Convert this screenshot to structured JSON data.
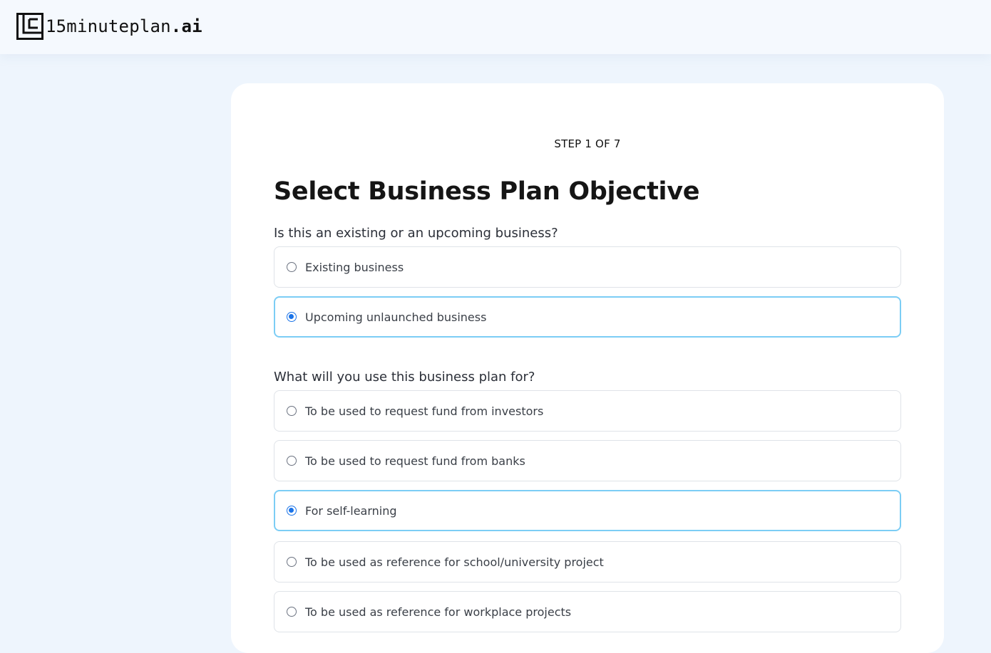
{
  "brand": {
    "name": "15minuteplan",
    "tld": ".ai"
  },
  "form": {
    "step_label": "STEP 1 OF 7",
    "title": "Select Business Plan Objective",
    "question_1": {
      "text": "Is this an existing or an upcoming business?",
      "options": [
        {
          "label": "Existing business",
          "selected": false
        },
        {
          "label": "Upcoming unlaunched business",
          "selected": true
        }
      ]
    },
    "question_2": {
      "text": "What will you use this business plan for?",
      "options": [
        {
          "label": "To be used to request fund from investors",
          "selected": false
        },
        {
          "label": "To be used to request fund from banks",
          "selected": false
        },
        {
          "label": "For self-learning",
          "selected": true
        },
        {
          "label": "To be used as reference for school/university project",
          "selected": false
        },
        {
          "label": "To be used as reference for workplace projects",
          "selected": false
        }
      ]
    }
  },
  "colors": {
    "accent": "#1a73e8",
    "selected_border": "#7ccdf5",
    "page_bg": "#eef5fd"
  }
}
